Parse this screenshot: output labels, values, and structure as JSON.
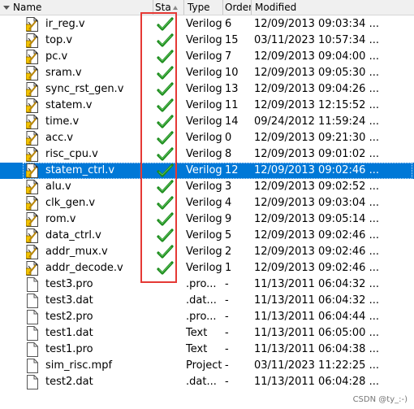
{
  "header": {
    "name_label": "Name",
    "status_label": "Sta",
    "type_label": "Type",
    "order_label": "Order",
    "modified_label": "Modified"
  },
  "files": [
    {
      "name": "ir_reg.v",
      "status": "compiled",
      "type": "Verilog",
      "order": "6",
      "modified": "12/09/2013 09:03:34 ..."
    },
    {
      "name": "top.v",
      "status": "compiled",
      "type": "Verilog",
      "order": "15",
      "modified": "03/11/2023 10:57:34 ..."
    },
    {
      "name": "pc.v",
      "status": "compiled",
      "type": "Verilog",
      "order": "7",
      "modified": "12/09/2013 09:04:00 ..."
    },
    {
      "name": "sram.v",
      "status": "compiled",
      "type": "Verilog",
      "order": "10",
      "modified": "12/09/2013 09:05:30 ..."
    },
    {
      "name": "sync_rst_gen.v",
      "status": "compiled",
      "type": "Verilog",
      "order": "13",
      "modified": "12/09/2013 09:04:26 ..."
    },
    {
      "name": "statem.v",
      "status": "compiled",
      "type": "Verilog",
      "order": "11",
      "modified": "12/09/2013 12:15:52 ..."
    },
    {
      "name": "time.v",
      "status": "compiled",
      "type": "Verilog",
      "order": "14",
      "modified": "09/24/2012 11:59:24 ..."
    },
    {
      "name": "acc.v",
      "status": "compiled",
      "type": "Verilog",
      "order": "0",
      "modified": "12/09/2013 09:21:30 ..."
    },
    {
      "name": "risc_cpu.v",
      "status": "compiled",
      "type": "Verilog",
      "order": "8",
      "modified": "12/09/2013 09:01:02 ..."
    },
    {
      "name": "statem_ctrl.v",
      "status": "compiled",
      "type": "Verilog",
      "order": "12",
      "modified": "12/09/2013 09:02:46 ...",
      "selected": true
    },
    {
      "name": "alu.v",
      "status": "compiled",
      "type": "Verilog",
      "order": "3",
      "modified": "12/09/2013 09:02:52 ..."
    },
    {
      "name": "clk_gen.v",
      "status": "compiled",
      "type": "Verilog",
      "order": "4",
      "modified": "12/09/2013 09:03:04 ..."
    },
    {
      "name": "rom.v",
      "status": "compiled",
      "type": "Verilog",
      "order": "9",
      "modified": "12/09/2013 09:05:14 ..."
    },
    {
      "name": "data_ctrl.v",
      "status": "compiled",
      "type": "Verilog",
      "order": "5",
      "modified": "12/09/2013 09:02:46 ..."
    },
    {
      "name": "addr_mux.v",
      "status": "compiled",
      "type": "Verilog",
      "order": "2",
      "modified": "12/09/2013 09:02:46 ..."
    },
    {
      "name": "addr_decode.v",
      "status": "compiled",
      "type": "Verilog",
      "order": "1",
      "modified": "12/09/2013 09:02:46 ..."
    },
    {
      "name": "test3.pro",
      "status": "",
      "type": ".pro...",
      "order": "-",
      "modified": "11/13/2011 06:04:32 ..."
    },
    {
      "name": "test3.dat",
      "status": "",
      "type": ".dat...",
      "order": "-",
      "modified": "11/13/2011 06:04:32 ..."
    },
    {
      "name": "test2.pro",
      "status": "",
      "type": ".pro...",
      "order": "-",
      "modified": "11/13/2011 06:04:44 ..."
    },
    {
      "name": "test1.dat",
      "status": "",
      "type": "Text",
      "order": "-",
      "modified": "11/13/2011 06:05:00 ..."
    },
    {
      "name": "test1.pro",
      "status": "",
      "type": "Text",
      "order": "-",
      "modified": "11/13/2011 06:04:38 ..."
    },
    {
      "name": "sim_risc.mpf",
      "status": "",
      "type": "Project",
      "order": "-",
      "modified": "03/11/2023 11:22:25 ..."
    },
    {
      "name": "test2.dat",
      "status": "",
      "type": ".dat...",
      "order": "-",
      "modified": "11/13/2011 06:04:28 ..."
    }
  ],
  "colors": {
    "selection": "#0078d7",
    "check": "#1a8a1a",
    "annotation_box": "#e53935"
  },
  "watermark": "CSDN @ty_:-)"
}
